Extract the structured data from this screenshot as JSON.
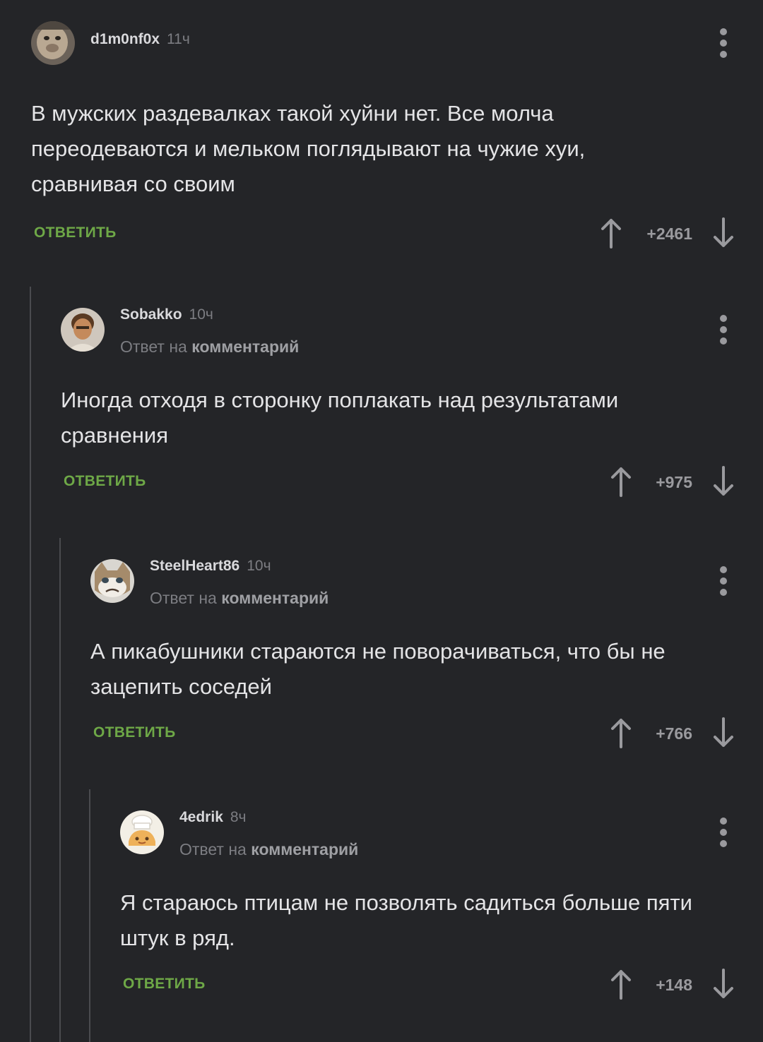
{
  "comments": [
    {
      "username": "d1m0nf0x",
      "time": "11ч",
      "reply_prefix": "",
      "reply_link": "",
      "text": "В мужских раздевалках такой хуйни нет. Все молча переодеваются и мельком поглядывают на чужие хуи, сравнивая со своим",
      "reply_label": "ОТВЕТИТЬ",
      "score": "+2461"
    },
    {
      "username": "Sobakko",
      "time": "10ч",
      "reply_prefix": "Ответ на",
      "reply_link": "комментарий",
      "text": "Иногда отходя в сторонку поплакать над результатами сравнения",
      "reply_label": "ОТВЕТИТЬ",
      "score": "+975"
    },
    {
      "username": "SteelHeart86",
      "time": "10ч",
      "reply_prefix": "Ответ на",
      "reply_link": "комментарий",
      "text": "А пикабушники стараются не поворачиваться, что бы не зацепить соседей",
      "reply_label": "ОТВЕТИТЬ",
      "score": "+766"
    },
    {
      "username": "4edrik",
      "time": "8ч",
      "reply_prefix": "Ответ на",
      "reply_link": "комментарий",
      "text": "Я стараюсь птицам не позволять садиться больше пяти штук в ряд.",
      "reply_label": "ОТВЕТИТЬ",
      "score": "+148"
    }
  ],
  "icons": {
    "menu": "more-vertical-icon",
    "upvote": "arrow-up-icon",
    "downvote": "arrow-down-icon"
  },
  "colors": {
    "background": "#242528",
    "reply_accent": "#6ea847",
    "muted": "#7c7d82",
    "thread_line": "#4a4b4f"
  }
}
